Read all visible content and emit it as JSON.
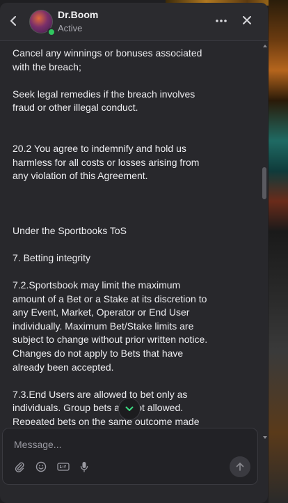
{
  "header": {
    "contact_name": "Dr.Boom",
    "status": "Active"
  },
  "message": {
    "paragraphs": [
      "Cancel any winnings or bonuses associated with the breach;",
      "Seek legal remedies if the breach involves fraud or other illegal conduct.",
      "20.2 You agree to indemnify and hold us harmless for all costs or losses arising from any violation of this Agreement.",
      "Under the Sportbooks ToS",
      "7. Betting integrity",
      "7.2.Sportsbook may limit the maximum amount of a Bet or a Stake at its discretion to any Event, Market, Operator or End User individually. Maximum Bet/Stake limits are subject to change without prior written notice. Changes do not apply to Bets that have already been accepted.",
      "7.3.End Users are allowed to bet only as individuals. Group bets are not allowed. Repeated bets on the same outcome made"
    ]
  },
  "composer": {
    "placeholder": "Message..."
  },
  "icons": {
    "back": "chevron-left-icon",
    "more": "more-horizontal-icon",
    "close": "close-icon",
    "jump": "chevron-down-icon",
    "attach": "paperclip-icon",
    "emoji": "emoji-icon",
    "gif": "gif-icon",
    "mic": "microphone-icon",
    "send": "arrow-up-icon"
  },
  "colors": {
    "presence": "#31c760",
    "jump_chevron": "#3ddc84"
  }
}
